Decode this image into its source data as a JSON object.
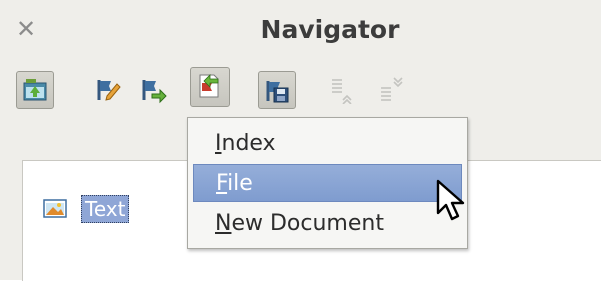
{
  "window": {
    "title": "Navigator",
    "close_icon": "close-icon"
  },
  "toolbar": {
    "buttons": [
      {
        "icon": "navigator-toggle-icon",
        "pressed": true
      },
      {
        "icon": "edit-pencil-icon",
        "pressed": false
      },
      {
        "icon": "go-to-next-icon",
        "pressed": false
      },
      {
        "icon": "drag-mode-icon",
        "pressed": true
      },
      {
        "icon": "save-document-icon",
        "pressed": true
      },
      {
        "icon": "promote-level-icon",
        "pressed": false,
        "disabled": true
      },
      {
        "icon": "demote-level-icon",
        "pressed": false,
        "disabled": true
      }
    ]
  },
  "tree": {
    "items": [
      {
        "label": "Text",
        "icon": "text-document-icon",
        "selected": true
      }
    ]
  },
  "dropdown_menu": {
    "items": [
      {
        "label": "Index",
        "mnemonic": "I",
        "rest": "ndex",
        "highlighted": false
      },
      {
        "label": "File",
        "mnemonic": "F",
        "rest": "ile",
        "highlighted": true
      },
      {
        "label": "New Document",
        "mnemonic": "N",
        "rest": "ew Document",
        "highlighted": false
      }
    ]
  },
  "colors": {
    "panel_bg": "#efeeea",
    "highlight": "#8fa6d6",
    "menu_bg": "#f6f6f4"
  }
}
